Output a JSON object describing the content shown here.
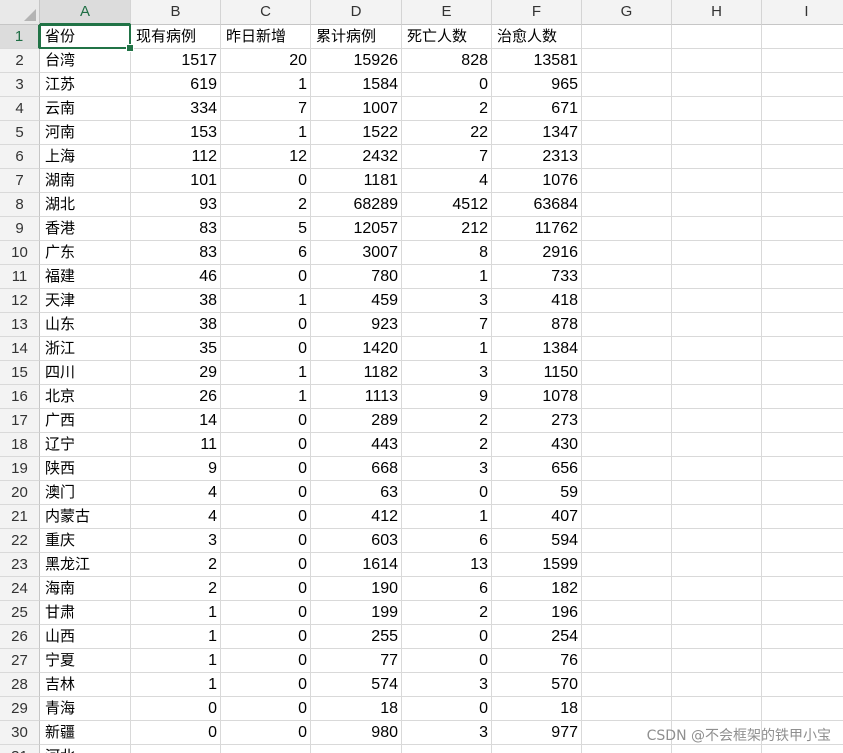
{
  "columns": [
    "A",
    "B",
    "C",
    "D",
    "E",
    "F",
    "G",
    "H",
    "I"
  ],
  "active_cell": "A1",
  "accent_color": "#217346",
  "rows": [
    {
      "n": "1",
      "cells": [
        "省份",
        "现有病例",
        "昨日新增",
        "累计病例",
        "死亡人数",
        "治愈人数"
      ]
    },
    {
      "n": "2",
      "cells": [
        "台湾",
        "1517",
        "20",
        "15926",
        "828",
        "13581"
      ]
    },
    {
      "n": "3",
      "cells": [
        "江苏",
        "619",
        "1",
        "1584",
        "0",
        "965"
      ]
    },
    {
      "n": "4",
      "cells": [
        "云南",
        "334",
        "7",
        "1007",
        "2",
        "671"
      ]
    },
    {
      "n": "5",
      "cells": [
        "河南",
        "153",
        "1",
        "1522",
        "22",
        "1347"
      ]
    },
    {
      "n": "6",
      "cells": [
        "上海",
        "112",
        "12",
        "2432",
        "7",
        "2313"
      ]
    },
    {
      "n": "7",
      "cells": [
        "湖南",
        "101",
        "0",
        "1181",
        "4",
        "1076"
      ]
    },
    {
      "n": "8",
      "cells": [
        "湖北",
        "93",
        "2",
        "68289",
        "4512",
        "63684"
      ]
    },
    {
      "n": "9",
      "cells": [
        "香港",
        "83",
        "5",
        "12057",
        "212",
        "11762"
      ]
    },
    {
      "n": "10",
      "cells": [
        "广东",
        "83",
        "6",
        "3007",
        "8",
        "2916"
      ]
    },
    {
      "n": "11",
      "cells": [
        "福建",
        "46",
        "0",
        "780",
        "1",
        "733"
      ]
    },
    {
      "n": "12",
      "cells": [
        "天津",
        "38",
        "1",
        "459",
        "3",
        "418"
      ]
    },
    {
      "n": "13",
      "cells": [
        "山东",
        "38",
        "0",
        "923",
        "7",
        "878"
      ]
    },
    {
      "n": "14",
      "cells": [
        "浙江",
        "35",
        "0",
        "1420",
        "1",
        "1384"
      ]
    },
    {
      "n": "15",
      "cells": [
        "四川",
        "29",
        "1",
        "1182",
        "3",
        "1150"
      ]
    },
    {
      "n": "16",
      "cells": [
        "北京",
        "26",
        "1",
        "1113",
        "9",
        "1078"
      ]
    },
    {
      "n": "17",
      "cells": [
        "广西",
        "14",
        "0",
        "289",
        "2",
        "273"
      ]
    },
    {
      "n": "18",
      "cells": [
        "辽宁",
        "11",
        "0",
        "443",
        "2",
        "430"
      ]
    },
    {
      "n": "19",
      "cells": [
        "陕西",
        "9",
        "0",
        "668",
        "3",
        "656"
      ]
    },
    {
      "n": "20",
      "cells": [
        "澳门",
        "4",
        "0",
        "63",
        "0",
        "59"
      ]
    },
    {
      "n": "21",
      "cells": [
        "内蒙古",
        "4",
        "0",
        "412",
        "1",
        "407"
      ]
    },
    {
      "n": "22",
      "cells": [
        "重庆",
        "3",
        "0",
        "603",
        "6",
        "594"
      ]
    },
    {
      "n": "23",
      "cells": [
        "黑龙江",
        "2",
        "0",
        "1614",
        "13",
        "1599"
      ]
    },
    {
      "n": "24",
      "cells": [
        "海南",
        "2",
        "0",
        "190",
        "6",
        "182"
      ]
    },
    {
      "n": "25",
      "cells": [
        "甘肃",
        "1",
        "0",
        "199",
        "2",
        "196"
      ]
    },
    {
      "n": "26",
      "cells": [
        "山西",
        "1",
        "0",
        "255",
        "0",
        "254"
      ]
    },
    {
      "n": "27",
      "cells": [
        "宁夏",
        "1",
        "0",
        "77",
        "0",
        "76"
      ]
    },
    {
      "n": "28",
      "cells": [
        "吉林",
        "1",
        "0",
        "574",
        "3",
        "570"
      ]
    },
    {
      "n": "29",
      "cells": [
        "青海",
        "0",
        "0",
        "18",
        "0",
        "18"
      ]
    },
    {
      "n": "30",
      "cells": [
        "新疆",
        "0",
        "0",
        "980",
        "3",
        "977"
      ]
    },
    {
      "n": "31",
      "cells": [
        "河北",
        "",
        "",
        "",
        "",
        ""
      ]
    }
  ],
  "watermark": "CSDN @不会框架的铁甲小宝"
}
